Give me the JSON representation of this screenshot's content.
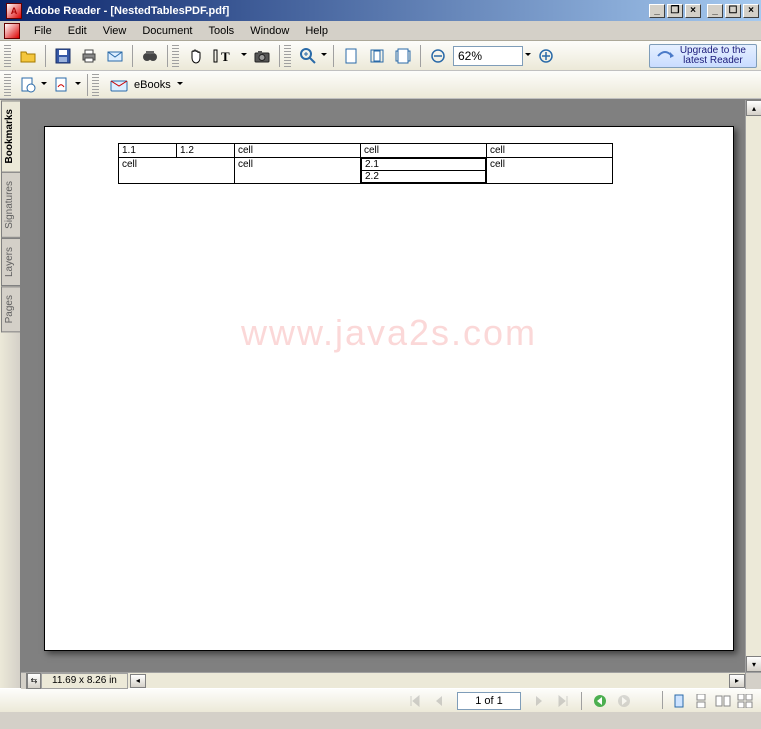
{
  "window": {
    "title": "Adobe Reader - [NestedTablesPDF.pdf]"
  },
  "menu": {
    "items": [
      "File",
      "Edit",
      "View",
      "Document",
      "Tools",
      "Window",
      "Help"
    ]
  },
  "toolbar": {
    "zoom_value": "62%",
    "upgrade_line1": "Upgrade to the",
    "upgrade_line2": "latest Reader",
    "ebooks_label": "eBooks"
  },
  "side_tabs": [
    "Bookmarks",
    "Signatures",
    "Layers",
    "Pages"
  ],
  "document": {
    "watermark": "www.java2s.com",
    "table": {
      "row1": {
        "c1a": "1.1",
        "c1b": "1.2",
        "c2": "cell",
        "c3": "cell",
        "c4": "cell"
      },
      "row2": {
        "c1": "cell",
        "c2": "cell",
        "c3_inner": [
          "2.1",
          "2.2"
        ],
        "c4": "cell"
      }
    }
  },
  "statusbar": {
    "dimensions": "11.69 x 8.26 in",
    "page_indicator": "1 of 1"
  }
}
